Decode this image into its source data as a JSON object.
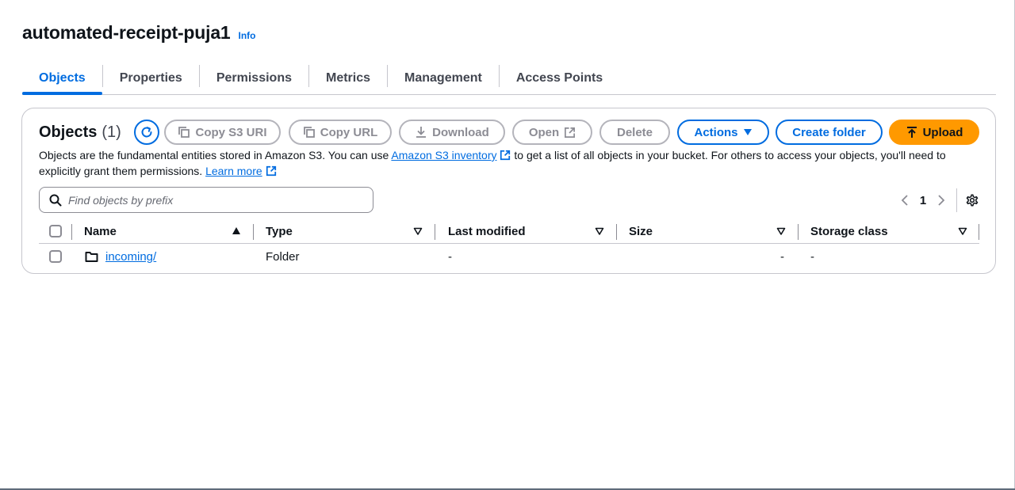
{
  "bucket": {
    "name": "automated-receipt-puja1",
    "info_label": "Info"
  },
  "tabs": [
    {
      "label": "Objects",
      "active": true
    },
    {
      "label": "Properties",
      "active": false
    },
    {
      "label": "Permissions",
      "active": false
    },
    {
      "label": "Metrics",
      "active": false
    },
    {
      "label": "Management",
      "active": false
    },
    {
      "label": "Access Points",
      "active": false
    }
  ],
  "objects_panel": {
    "title": "Objects",
    "count": "(1)",
    "buttons": {
      "copy_s3_uri": "Copy S3 URI",
      "copy_url": "Copy URL",
      "download": "Download",
      "open": "Open",
      "delete": "Delete",
      "actions": "Actions",
      "create_folder": "Create folder",
      "upload": "Upload"
    },
    "description": {
      "part1": "Objects are the fundamental entities stored in Amazon S3. You can use ",
      "inventory_link": "Amazon S3 inventory",
      "part2": " to get a list of all objects in your bucket. For others to access your objects, you'll need to explicitly grant them permissions. ",
      "learn_more": "Learn more"
    },
    "search": {
      "placeholder": "Find objects by prefix",
      "value": ""
    },
    "pagination": {
      "current_page": "1"
    },
    "columns": [
      "Name",
      "Type",
      "Last modified",
      "Size",
      "Storage class"
    ],
    "rows": [
      {
        "name": "incoming/",
        "type": "Folder",
        "last_modified": "-",
        "size": "-",
        "storage_class": "-"
      }
    ]
  },
  "colors": {
    "link_blue": "#006ce0",
    "upload_orange": "#ff9900",
    "border_gray": "#c6c6cd"
  }
}
